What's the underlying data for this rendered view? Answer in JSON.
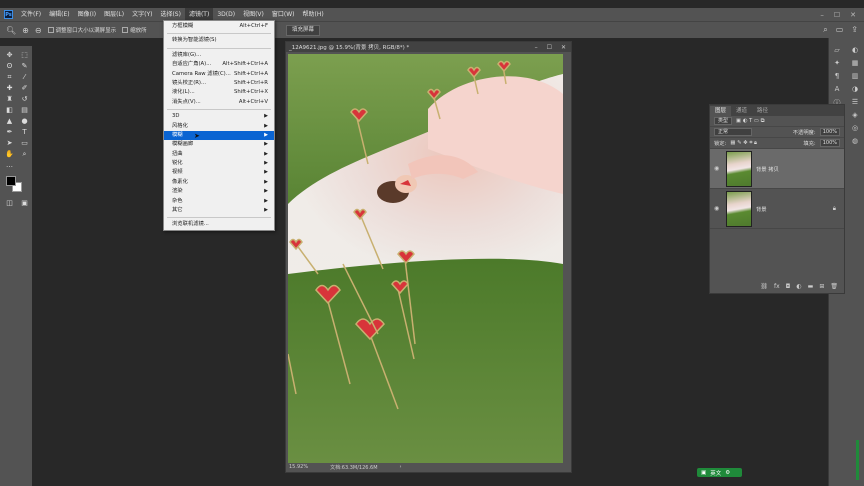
{
  "menubar": {
    "logo": "Ps",
    "items": [
      "文件(F)",
      "编辑(E)",
      "图像(I)",
      "图层(L)",
      "文字(Y)",
      "选择(S)",
      "滤镜(T)",
      "3D(D)",
      "视图(V)",
      "窗口(W)",
      "帮助(H)"
    ],
    "active_index": 6
  },
  "optbar": {
    "check1": "调整窗口大小以满屏显示",
    "check2": "缩放所",
    "fill_button": "填充屏幕"
  },
  "filter_menu": {
    "items": [
      {
        "label": "方框模糊",
        "shortcut": "Alt+Ctrl+F"
      },
      {
        "sep": true
      },
      {
        "label": "转换为智能滤镜(S)"
      },
      {
        "sep": true
      },
      {
        "label": "滤镜库(G)..."
      },
      {
        "label": "自适应广角(A)...",
        "shortcut": "Alt+Shift+Ctrl+A"
      },
      {
        "label": "Camera Raw 滤镜(C)...",
        "shortcut": "Shift+Ctrl+A"
      },
      {
        "label": "镜头校正(R)...",
        "shortcut": "Shift+Ctrl+R"
      },
      {
        "label": "液化(L)...",
        "shortcut": "Shift+Ctrl+X"
      },
      {
        "label": "消失点(V)...",
        "shortcut": "Alt+Ctrl+V"
      },
      {
        "sep": true
      },
      {
        "label": "3D",
        "submenu": true
      },
      {
        "label": "风格化",
        "submenu": true
      },
      {
        "label": "模糊",
        "submenu": true,
        "highlighted": true
      },
      {
        "label": "模糊画廊",
        "submenu": true
      },
      {
        "label": "扭曲",
        "submenu": true
      },
      {
        "label": "锐化",
        "submenu": true
      },
      {
        "label": "视频",
        "submenu": true
      },
      {
        "label": "像素化",
        "submenu": true
      },
      {
        "label": "渲染",
        "submenu": true
      },
      {
        "label": "杂色",
        "submenu": true
      },
      {
        "label": "其它",
        "submenu": true
      },
      {
        "sep": true
      },
      {
        "label": "浏览联机滤镜..."
      }
    ]
  },
  "document": {
    "tab_title": "_12A9621.jpg @ 15.9%(背景 拷贝, RGB/8*) *",
    "zoom": "15.92%",
    "doc_size": "文档:63.3M/126.6M"
  },
  "layers_panel": {
    "tabs": [
      "图层",
      "通道",
      "路径"
    ],
    "kind": "类型",
    "blend_mode": "正常",
    "opacity_label": "不透明度:",
    "opacity_value": "100%",
    "lock_label": "锁定:",
    "fill_label": "填充:",
    "fill_value": "100%",
    "layers": [
      {
        "name": "背景 拷贝",
        "selected": true
      },
      {
        "name": "背景",
        "locked": true
      }
    ]
  },
  "ime": {
    "label": "英文"
  },
  "colors": {
    "highlight": "#0a64d2",
    "ime_green": "#1f8a3a"
  }
}
